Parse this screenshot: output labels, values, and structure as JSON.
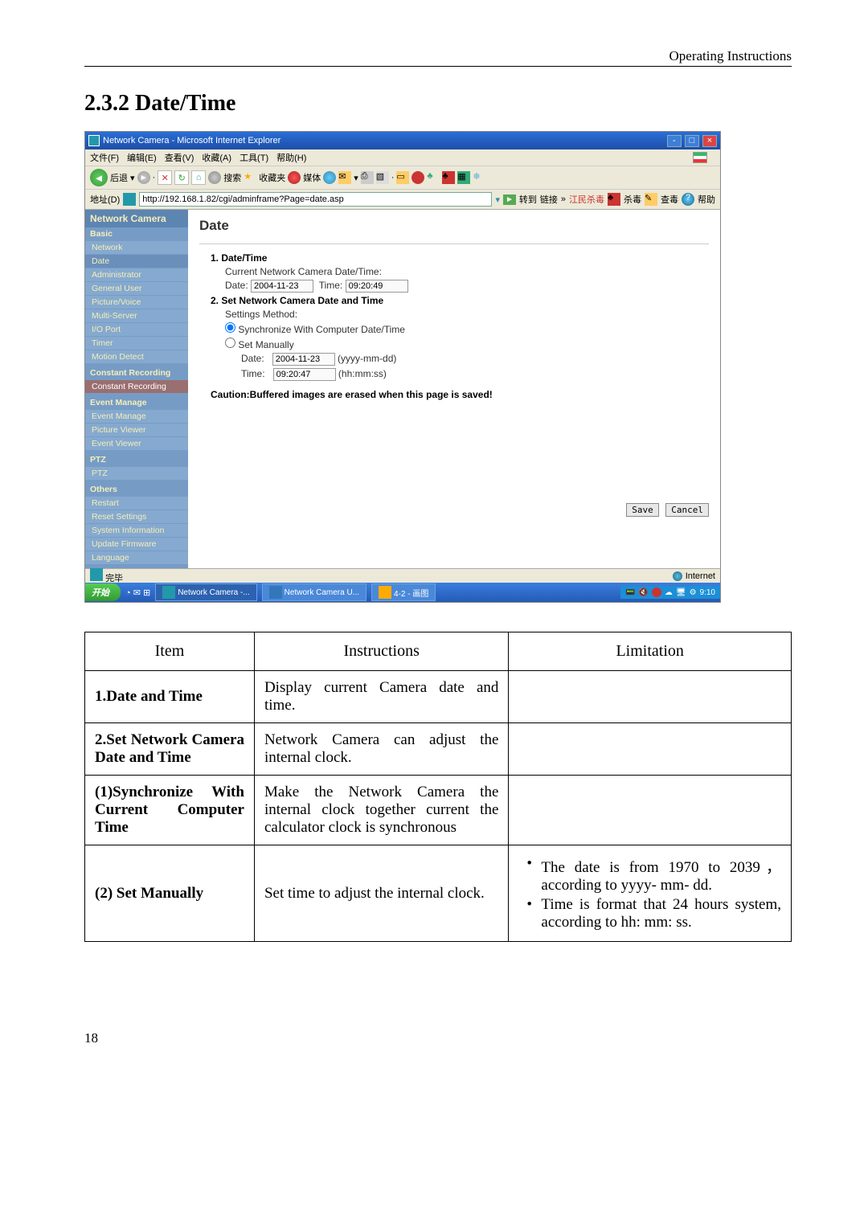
{
  "header": {
    "right": "Operating Instructions"
  },
  "section_title": "2.3.2 Date/Time",
  "ie": {
    "title": "Network Camera - Microsoft Internet Explorer",
    "menu": [
      "文件(F)",
      "编辑(E)",
      "查看(V)",
      "收藏(A)",
      "工具(T)",
      "帮助(H)"
    ],
    "back": "后退",
    "tool": {
      "search": "搜索",
      "fav": "收藏夹",
      "media": "媒体"
    },
    "addr_label": "地址(D)",
    "addr": "http://192.168.1.82/cgi/adminframe?Page=date.asp",
    "go": "转到",
    "link": "链接",
    "jr": "江民杀毒",
    "sd": "杀毒",
    "cb": "查毒",
    "hp": "帮助",
    "sidebar": {
      "head": "Network Camera",
      "groups": {
        "basic": "Basic",
        "basic_items": [
          "Network",
          "Date",
          "Administrator",
          "General User",
          "Picture/Voice",
          "Multi-Server",
          "I/O Port",
          "Timer",
          "Motion Detect"
        ],
        "cr": "Constant Recording",
        "cr_items": [
          "Constant Recording"
        ],
        "em": "Event Manage",
        "em_items": [
          "Event Manage",
          "Picture Viewer",
          "Event Viewer"
        ],
        "ptz": "PTZ",
        "ptz_items": [
          "PTZ"
        ],
        "others": "Others",
        "others_items": [
          "Restart",
          "Reset Settings",
          "System Information",
          "Update Firmware",
          "Language"
        ]
      }
    },
    "panel": {
      "title": "Date",
      "h1": "1. Date/Time",
      "cur": "Current Network Camera Date/Time:",
      "date_lbl": "Date:",
      "date_val": "2004-11-23",
      "time_lbl": "Time:",
      "time_val": "09:20:49",
      "h2": "2. Set Network Camera Date and Time",
      "sm": "Settings Method:",
      "r1": "Synchronize With Computer Date/Time",
      "r2": "Set Manually",
      "d2l": "Date:",
      "d2v": "2004-11-23",
      "d2h": "(yyyy-mm-dd)",
      "t2l": "Time:",
      "t2v": "09:20:47",
      "t2h": "(hh:mm:ss)",
      "caution": "Caution:Buffered images are erased when this page is saved!",
      "save": "Save",
      "cancel": "Cancel"
    },
    "status": {
      "left": "完毕",
      "right": "Internet"
    },
    "taskbar": {
      "start": "开始",
      "t1": "Network Camera -...",
      "t2": "Network Camera U...",
      "t3": "4-2 - 画图",
      "time": "9:10"
    }
  },
  "table": {
    "head": {
      "c1": "Item",
      "c2": "Instructions",
      "c3": "Limitation"
    },
    "rows": [
      {
        "c1": "1.Date and Time",
        "c2": "Display current Camera date and time.",
        "c3": ""
      },
      {
        "c1": "2.Set Network Camera Date and Time",
        "c2": "Network Camera can adjust the internal clock.",
        "c3": ""
      },
      {
        "c1": "(1)Synchronize With Current Computer Time",
        "c2": "Make the Network Camera the internal clock together current the calculator clock is synchronous",
        "c3": ""
      },
      {
        "c1": "(2) Set Manually",
        "c2": "Set time to adjust the internal clock.",
        "c3_b1": "The date is from 1970 to 2039，according to yyyy- mm- dd.",
        "c3_b2": "Time is format that 24 hours system, according to hh: mm: ss."
      }
    ]
  },
  "footer": "18"
}
